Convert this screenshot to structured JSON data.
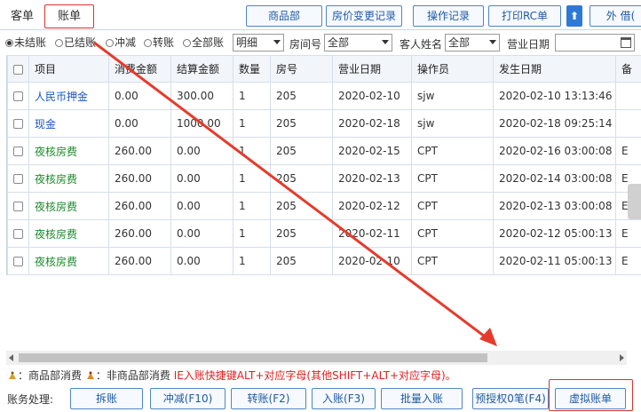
{
  "tabs": [
    {
      "label": "客单"
    },
    {
      "label": "账单"
    }
  ],
  "top_buttons": [
    {
      "label": "商品部"
    },
    {
      "label": "房价变更记录"
    },
    {
      "label": "操作记录"
    },
    {
      "label": "打印RC单"
    },
    {
      "label": "⬆"
    },
    {
      "label": "外 借("
    }
  ],
  "filters": {
    "status_options": [
      "未结账",
      "已结账",
      "冲减",
      "转账",
      "全部账"
    ],
    "status_selected": "未结账",
    "detail_select": "明细",
    "room_label": "房间号",
    "room_select": "全部",
    "guest_label": "客人姓名",
    "guest_select": "全部",
    "date_label": "营业日期"
  },
  "table": {
    "columns": [
      "项目",
      "消费金额",
      "结算金额",
      "数量",
      "房号",
      "营业日期",
      "操作员",
      "发生日期",
      "备"
    ],
    "rows": [
      {
        "item": "人民币押金",
        "color": "blue",
        "consume": "0.00",
        "settle": "300.00",
        "qty": "1",
        "room": "205",
        "bizdate": "2020-02-10",
        "operator": "sjw",
        "occur": "2020-02-10 13:13:46",
        "note": ""
      },
      {
        "item": "现金",
        "color": "blue",
        "consume": "0.00",
        "settle": "1000.00",
        "qty": "1",
        "room": "205",
        "bizdate": "2020-02-18",
        "operator": "sjw",
        "occur": "2020-02-18 09:25:14",
        "note": ""
      },
      {
        "item": "夜核房费",
        "color": "green",
        "consume": "260.00",
        "settle": "0.00",
        "qty": "1",
        "room": "205",
        "bizdate": "2020-02-15",
        "operator": "CPT",
        "occur": "2020-02-16 03:00:08",
        "note": "E"
      },
      {
        "item": "夜核房费",
        "color": "green",
        "consume": "260.00",
        "settle": "0.00",
        "qty": "1",
        "room": "205",
        "bizdate": "2020-02-13",
        "operator": "CPT",
        "occur": "2020-02-14 03:00:08",
        "note": "E"
      },
      {
        "item": "夜核房费",
        "color": "green",
        "consume": "260.00",
        "settle": "0.00",
        "qty": "1",
        "room": "205",
        "bizdate": "2020-02-12",
        "operator": "CPT",
        "occur": "2020-02-13 03:00:08",
        "note": "E"
      },
      {
        "item": "夜核房费",
        "color": "green",
        "consume": "260.00",
        "settle": "0.00",
        "qty": "1",
        "room": "205",
        "bizdate": "2020-02-11",
        "operator": "CPT",
        "occur": "2020-02-12 05:00:13",
        "note": "E"
      },
      {
        "item": "夜核房费",
        "color": "green",
        "consume": "260.00",
        "settle": "0.00",
        "qty": "1",
        "room": "205",
        "bizdate": "2020-02-10",
        "operator": "CPT",
        "occur": "2020-02-11 05:00:13",
        "note": "E"
      }
    ]
  },
  "legend": {
    "goods": "：商品部消费",
    "nongoods": "：非商品部消费",
    "hint": "IE入账快捷键ALT+对应字母(其他SHIFT+ALT+对应字母)。"
  },
  "bottom": {
    "label": "账务处理:",
    "buttons": [
      "拆账",
      "冲减(F10)",
      "转账(F2)",
      "入账(F3)",
      "批量入账",
      "预授权0笔(F4)",
      "虚拟账单"
    ]
  },
  "colors": {
    "accent_blue": "#1f5aa6",
    "highlight_red": "#d9342b",
    "row_blue": "#1a55c4",
    "row_green": "#1b8a2a",
    "hint_red": "#e02020"
  }
}
